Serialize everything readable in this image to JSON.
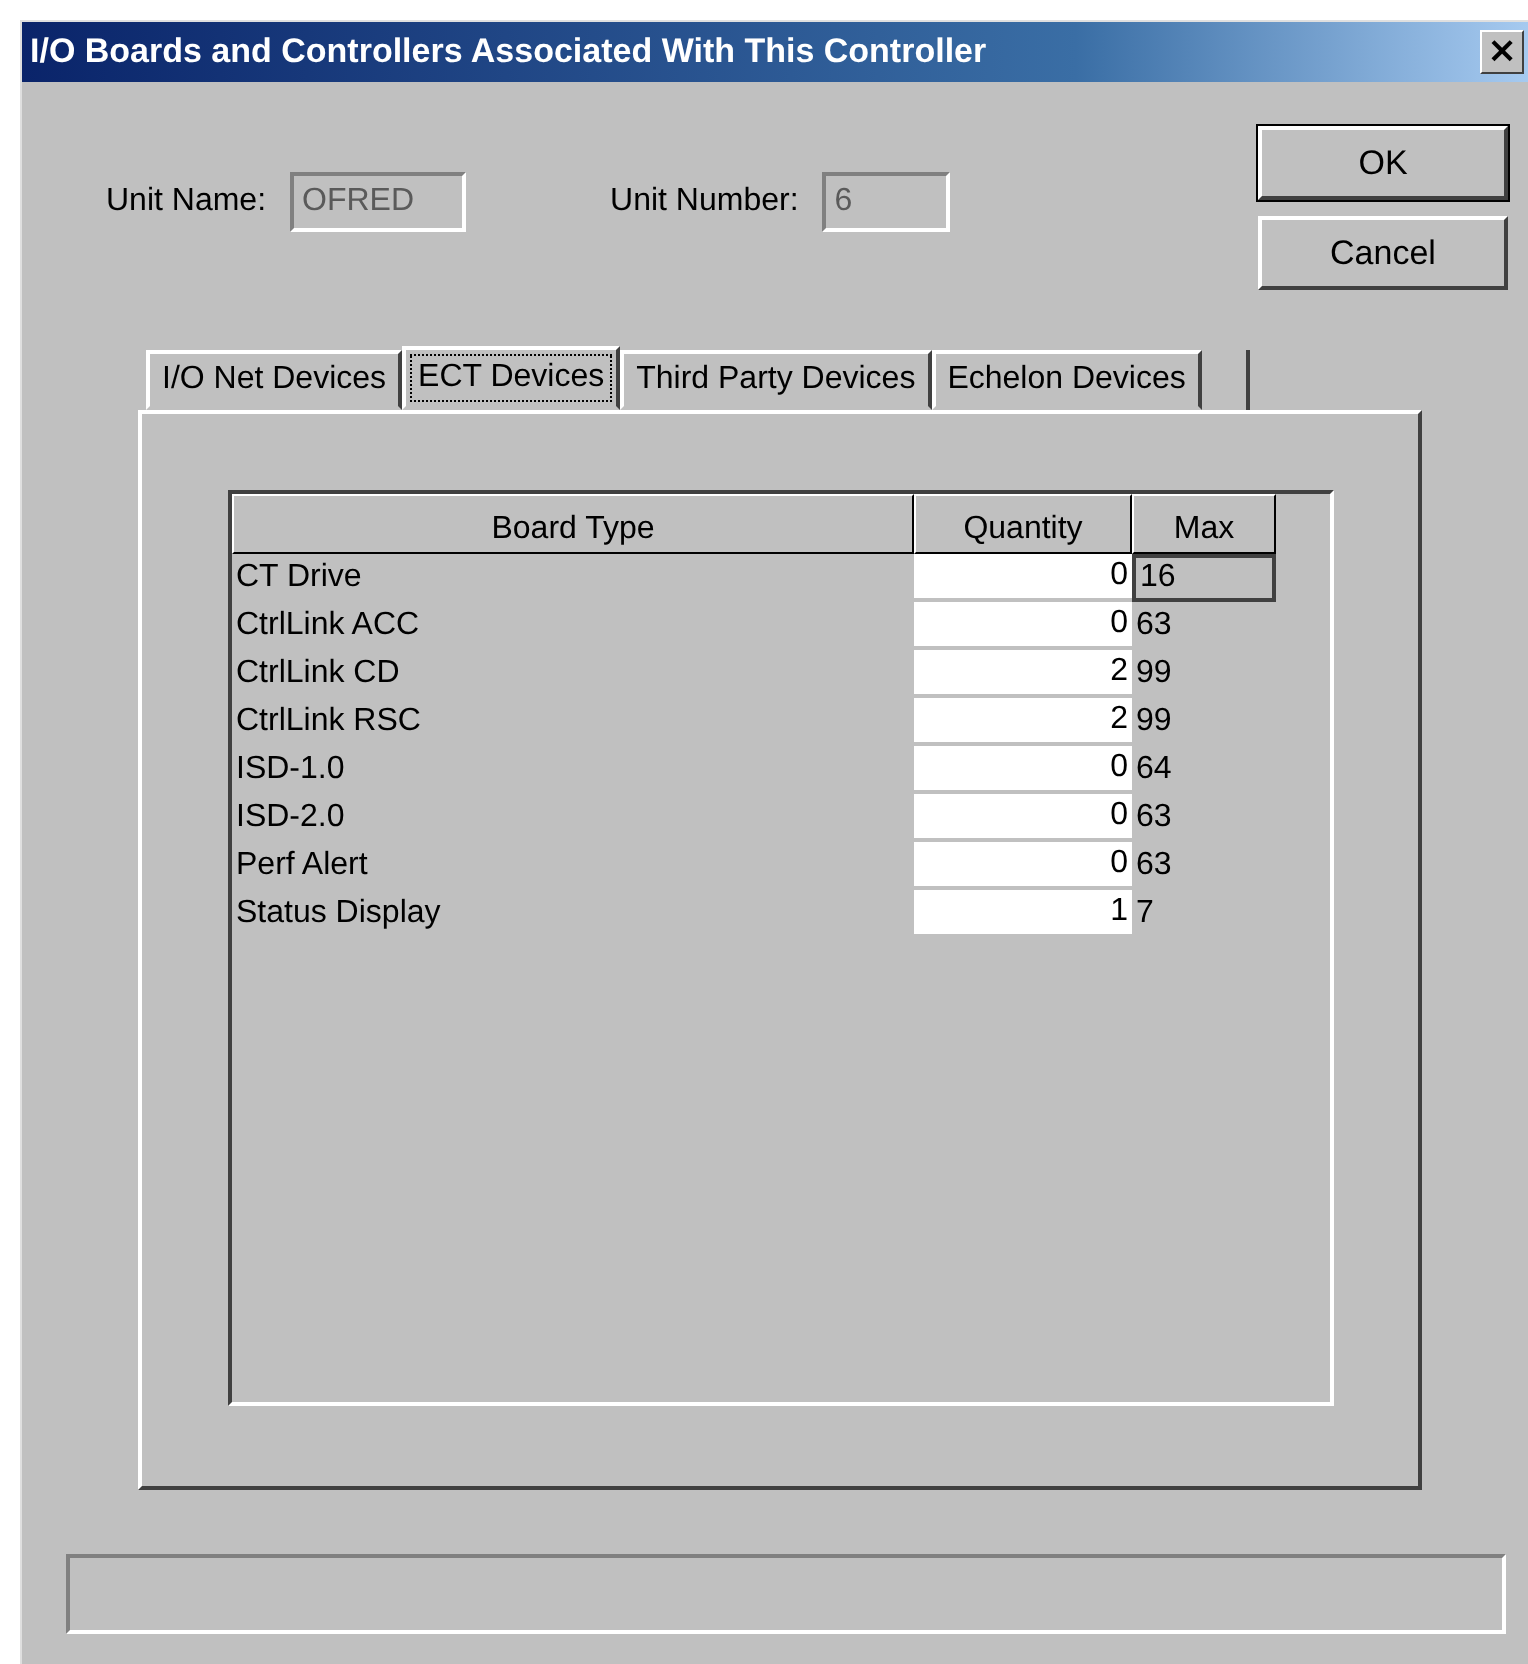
{
  "window": {
    "title": "I/O Boards and Controllers Associated With This Controller",
    "close": "×"
  },
  "unit_name": {
    "label": "Unit Name:",
    "value": "OFRED",
    "disabled": true
  },
  "unit_number": {
    "label": "Unit Number:",
    "value": "6",
    "disabled": true
  },
  "buttons": [
    {
      "label": "OK",
      "default": true
    },
    {
      "label": "Cancel",
      "default": false
    }
  ],
  "tabs": [
    {
      "label": "I/O Net Devices",
      "selected": false
    },
    {
      "label": "ECT Devices",
      "selected": true
    },
    {
      "label": "Third Party Devices",
      "selected": false
    },
    {
      "label": "Echelon Devices",
      "selected": false
    }
  ],
  "table": {
    "columns": [
      "Board Type",
      "Quantity",
      "Max"
    ],
    "rows": [
      {
        "board_type": "CT Drive",
        "quantity": "0",
        "max": "16",
        "focused": true
      },
      {
        "board_type": "CtrlLink ACC",
        "quantity": "0",
        "max": "63",
        "focused": false
      },
      {
        "board_type": "CtrlLink CD",
        "quantity": "2",
        "max": "99",
        "focused": false
      },
      {
        "board_type": "CtrlLink RSC",
        "quantity": "2",
        "max": "99",
        "focused": false
      },
      {
        "board_type": "ISD-1.0",
        "quantity": "0",
        "max": "64",
        "focused": false
      },
      {
        "board_type": "ISD-2.0",
        "quantity": "0",
        "max": "63",
        "focused": false
      },
      {
        "board_type": "Perf Alert",
        "quantity": "0",
        "max": "63",
        "focused": false
      },
      {
        "board_type": "Status Display",
        "quantity": "1",
        "max": "7",
        "focused": false
      }
    ]
  }
}
